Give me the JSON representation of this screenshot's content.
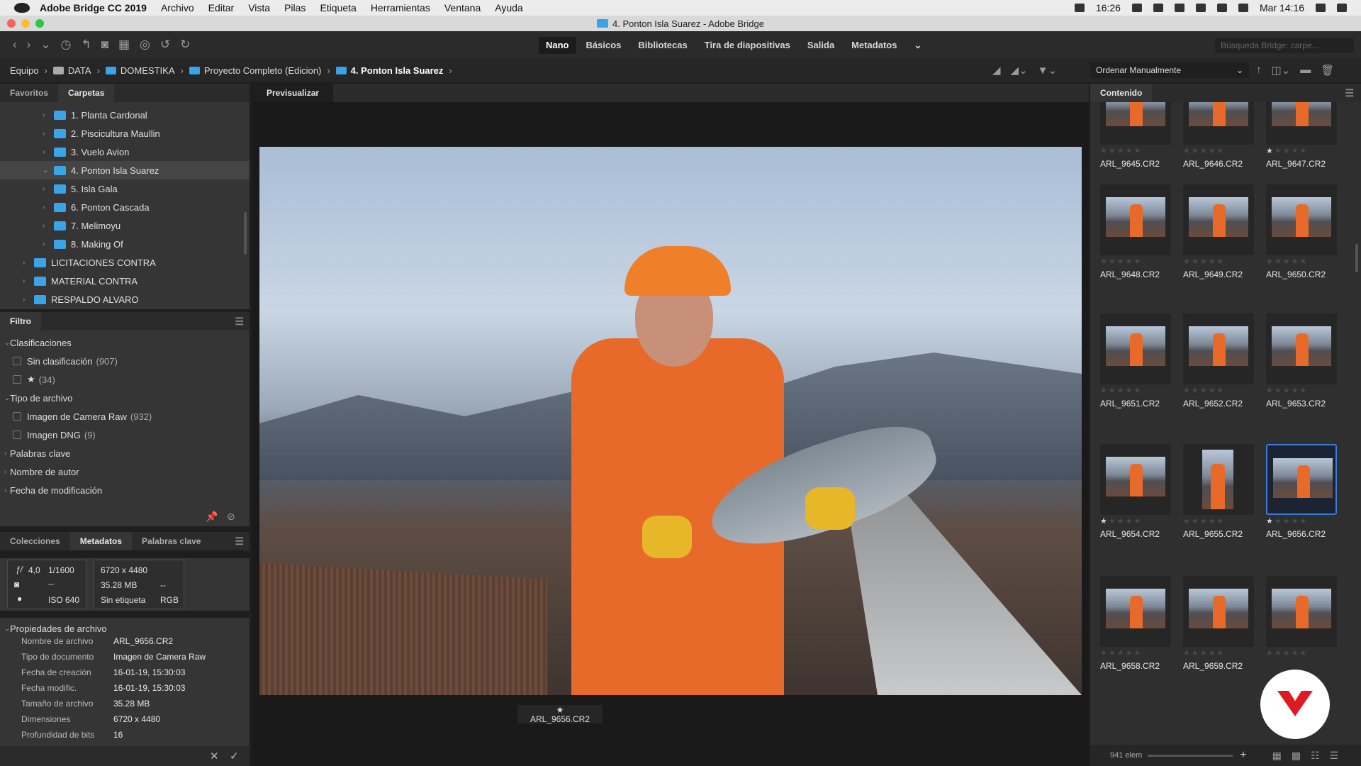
{
  "menubar": {
    "app_name": "Adobe Bridge CC 2019",
    "items": [
      "Archivo",
      "Editar",
      "Vista",
      "Pilas",
      "Etiqueta",
      "Herramientas",
      "Ventana",
      "Ayuda"
    ],
    "battery_time": "16:26",
    "clock": "Mar 14:16"
  },
  "window": {
    "title": "4. Ponton Isla Suarez - Adobe Bridge"
  },
  "workspaces": {
    "items": [
      "Nano",
      "Básicos",
      "Bibliotecas",
      "Tira de diapositivas",
      "Salida",
      "Metadatos"
    ],
    "active": "Nano"
  },
  "search": {
    "placeholder": "Búsqueda Bridge: carpe..."
  },
  "breadcrumb": {
    "items": [
      "Equipo",
      "DATA",
      "DOMESTIKA",
      "Proyecto Completo (Edicion)",
      "4. Ponton Isla Suarez"
    ]
  },
  "sort": {
    "label": "Ordenar Manualmente"
  },
  "left_tabs": {
    "favorites": "Favoritos",
    "folders": "Carpetas"
  },
  "folders": [
    {
      "label": "1. Planta Cardonal",
      "level": 2,
      "selected": false
    },
    {
      "label": "2. Piscicultura Maullin",
      "level": 2,
      "selected": false
    },
    {
      "label": "3. Vuelo Avion",
      "level": 2,
      "selected": false
    },
    {
      "label": "4. Ponton Isla Suarez",
      "level": 2,
      "selected": true
    },
    {
      "label": "5. Isla Gala",
      "level": 2,
      "selected": false
    },
    {
      "label": "6. Ponton Cascada",
      "level": 2,
      "selected": false
    },
    {
      "label": "7. Melimoyu",
      "level": 2,
      "selected": false
    },
    {
      "label": "8. Making Of",
      "level": 2,
      "selected": false
    },
    {
      "label": "LICITACIONES CONTRA",
      "level": 1,
      "selected": false
    },
    {
      "label": "MATERIAL CONTRA",
      "level": 1,
      "selected": false
    },
    {
      "label": "RESPALDO ALVARO",
      "level": 1,
      "selected": false
    }
  ],
  "filter": {
    "title": "Filtro",
    "rows": [
      {
        "type": "group",
        "label": "Clasificaciones",
        "expanded": true
      },
      {
        "type": "option",
        "label": "Sin clasificación",
        "count": "(907)"
      },
      {
        "type": "option",
        "label": "★",
        "count": "(34)"
      },
      {
        "type": "group",
        "label": "Tipo de archivo",
        "expanded": true
      },
      {
        "type": "option",
        "label": "Imagen de Camera Raw",
        "count": "(932)"
      },
      {
        "type": "option",
        "label": "Imagen DNG",
        "count": "(9)"
      },
      {
        "type": "group",
        "label": "Palabras clave",
        "expanded": false
      },
      {
        "type": "group",
        "label": "Nombre de autor",
        "expanded": false
      },
      {
        "type": "group",
        "label": "Fecha de modificación",
        "expanded": false
      }
    ]
  },
  "meta_tabs": {
    "collections": "Colecciones",
    "metadata": "Metadatos",
    "keywords": "Palabras clave"
  },
  "camera": {
    "aperture": "4,0",
    "shutter": "1/1600",
    "line2": "--",
    "iso": "ISO 640",
    "dimensions": "6720 x 4480",
    "size": "35.28 MB",
    "size_extra": "--",
    "label": "Sin etiqueta",
    "color_mode": "RGB"
  },
  "file_props": {
    "title": "Propiedades de archivo",
    "rows": [
      {
        "key": "Nombre de archivo",
        "value": "ARL_9656.CR2"
      },
      {
        "key": "Tipo de documento",
        "value": "Imagen de Camera Raw"
      },
      {
        "key": "Fecha de creación",
        "value": "16-01-19, 15:30:03"
      },
      {
        "key": "Fecha modific.",
        "value": "16-01-19, 15:30:03"
      },
      {
        "key": "Tamaño de archivo",
        "value": "35.28 MB"
      },
      {
        "key": "Dimensiones",
        "value": "6720 x 4480"
      },
      {
        "key": "Profundidad de bits",
        "value": "16"
      }
    ]
  },
  "preview": {
    "tab": "Previsualizar",
    "caption_star": "★",
    "caption": "ARL_9656.CR2"
  },
  "content": {
    "tab": "Contenido",
    "thumbnails": [
      {
        "name": "ARL_9645.CR2",
        "rating": 0,
        "portrait": false,
        "selected": false
      },
      {
        "name": "ARL_9646.CR2",
        "rating": 0,
        "portrait": false,
        "selected": false
      },
      {
        "name": "ARL_9647.CR2",
        "rating": 1,
        "portrait": false,
        "selected": false
      },
      {
        "name": "ARL_9648.CR2",
        "rating": 0,
        "portrait": false,
        "selected": false
      },
      {
        "name": "ARL_9649.CR2",
        "rating": 0,
        "portrait": false,
        "selected": false
      },
      {
        "name": "ARL_9650.CR2",
        "rating": 0,
        "portrait": false,
        "selected": false
      },
      {
        "name": "ARL_9651.CR2",
        "rating": 0,
        "portrait": false,
        "selected": false
      },
      {
        "name": "ARL_9652.CR2",
        "rating": 0,
        "portrait": false,
        "selected": false
      },
      {
        "name": "ARL_9653.CR2",
        "rating": 0,
        "portrait": false,
        "selected": false
      },
      {
        "name": "ARL_9654.CR2",
        "rating": 1,
        "portrait": false,
        "selected": false
      },
      {
        "name": "ARL_9655.CR2",
        "rating": 0,
        "portrait": true,
        "selected": false
      },
      {
        "name": "ARL_9656.CR2",
        "rating": 1,
        "portrait": false,
        "selected": true
      },
      {
        "name": "ARL_9658.CR2",
        "rating": 0,
        "portrait": false,
        "selected": false
      },
      {
        "name": "ARL_9659.CR2",
        "rating": 0,
        "portrait": false,
        "selected": false
      },
      {
        "name": "",
        "rating": 0,
        "portrait": false,
        "selected": false
      }
    ],
    "count_label": "941 elem"
  },
  "colors": {
    "accent": "#3b7ad9",
    "folder": "#3ba3e8",
    "panel": "#353535",
    "brand_red": "#e01a22"
  }
}
